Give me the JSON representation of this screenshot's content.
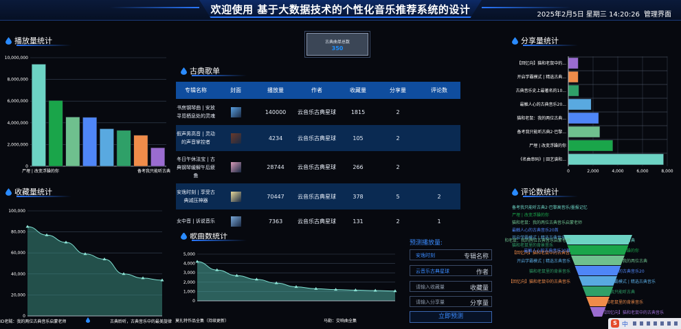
{
  "header": {
    "title": "欢迎使用 基于大数据技术的个性化音乐推荐系统的设计",
    "datetime": "2025年2月5日 星期三 14:20:26",
    "admin": "管理界面"
  },
  "summary": {
    "label": "古典曲单总数",
    "value": "350"
  },
  "panels": {
    "plays": "播放量统计",
    "collect": "收藏量统计",
    "table": "古典歌单",
    "songs": "歌曲数统计",
    "share": "分享量统计",
    "comments": "评论数统计"
  },
  "table": {
    "headers": [
      "专辑名称",
      "封面",
      "播放量",
      "作者",
      "收藏量",
      "分享量",
      "评论数"
    ],
    "rows": [
      {
        "name_line1": "书房钢琴曲 | 安放",
        "name_line2": "寻觅栖息处的灵魂",
        "plays": "140000",
        "author": "云音乐古典星球",
        "collect": "1815",
        "share": "2",
        "comments": ""
      },
      {
        "name_line1": "假声男高音 | 灵动",
        "name_line2": "的声音掌控者",
        "plays": "4234",
        "author": "云音乐古典星球",
        "collect": "105",
        "share": "2",
        "comments": ""
      },
      {
        "name_line1": "冬日午休法宝 | 古",
        "name_line2": "典钢琴缓解午后疲",
        "name_line3": "惫",
        "plays": "28744",
        "author": "云音乐古典星球",
        "collect": "266",
        "share": "2",
        "comments": ""
      },
      {
        "name_line1": "安逸时刻 | 享受古",
        "name_line2": "典减压神器",
        "plays": "70447",
        "author": "云音乐古典星球",
        "collect": "378",
        "share": "5",
        "comments": "2"
      },
      {
        "name_line1": "女中音 | 诉说音乐",
        "name_line2": "",
        "plays": "7363",
        "author": "云音乐古典星球",
        "collect": "131",
        "share": "2",
        "comments": "1"
      }
    ]
  },
  "predict": {
    "title": "预测播放量:",
    "fields": [
      {
        "value": "安逸时刻",
        "label": "专辑名称"
      },
      {
        "value": "云音乐古典星球",
        "label": "作者"
      },
      {
        "value": "请输入收藏量",
        "label": "收藏量"
      },
      {
        "value": "请输入分享量",
        "label": "分享量"
      }
    ],
    "button": "立即预测"
  },
  "chart_data": [
    {
      "type": "bar",
      "title": "播放量统计",
      "categories": [
        "尸埋 | 改变浮躁的你",
        "",
        "",
        "",
        "",
        "",
        "",
        "备考我只能听古典"
      ],
      "values": [
        9400000,
        6050000,
        4530000,
        4500000,
        3450000,
        3300000,
        2850000,
        1700000
      ],
      "colors": [
        "#6dd3c4",
        "#1aa54a",
        "#6fc08e",
        "#4f86f7",
        "#59a9e0",
        "#2fa068",
        "#f08c4a",
        "#9a6cd0"
      ],
      "yticks": [
        "0",
        "2,000,000",
        "4,000,000",
        "6,000,000",
        "8,000,000",
        "10,000,000"
      ],
      "ylim": [
        0,
        10000000
      ]
    },
    {
      "type": "area",
      "title": "收藏量统计",
      "values": [
        85000,
        77000,
        70000,
        59000,
        54000,
        40000,
        36000,
        34000
      ],
      "xlabels": [
        "ID老贼：我的两位古典音乐启蒙老师",
        "古典聆听，古典音乐中的最美旋律"
      ],
      "yticks": [
        "0",
        "20,000",
        "40,000",
        "60,000",
        "80,000",
        "100,000"
      ],
      "ylim": [
        0,
        100000
      ]
    },
    {
      "type": "area",
      "title": "歌曲数统计",
      "values": [
        4200,
        3300,
        2700,
        2300,
        1900,
        1500,
        1300,
        1200,
        1150,
        1100,
        1050
      ],
      "xlabels": [
        "莫扎特作品全集（持续更新）",
        "马勒：交响曲全集"
      ],
      "yticks": [
        "0",
        "1,000",
        "2,000",
        "3,000",
        "4,000",
        "5,000"
      ],
      "ylim": [
        0,
        5000
      ]
    },
    {
      "type": "bar",
      "title": "分享量统计",
      "orientation": "horizontal",
      "categories": [
        "【回忆向】猫和老鼠中的...",
        "开启学霸模式 | 精选古典...",
        "古典音乐史上最著名的10...",
        "最触人心的古典音乐20...",
        "猫和老鼠：我的两位古典...",
        "备考我只能听古典2·巴黎...",
        "尸埋 | 改变浮躁的你",
        "《名曲串码》| 田艺谱和..."
      ],
      "values": [
        800,
        800,
        850,
        1850,
        2450,
        2550,
        3600,
        7700
      ],
      "colors": [
        "#9a6cd0",
        "#f08c4a",
        "#2fa068",
        "#59a9e0",
        "#4f86f7",
        "#6fc08e",
        "#1aa54a",
        "#6dd3c4"
      ],
      "xticks": [
        "0",
        "2,000",
        "4,000",
        "6,000",
        "8,000"
      ],
      "xlim": [
        0,
        8000
      ]
    },
    {
      "type": "funnel",
      "title": "评论数统计",
      "legend": [
        "备考我只能听古典2·巴黎高音乐/墨报记忆",
        "尸埋 | 改变浮躁的你",
        "猫和老鼠：我的两位古典音乐启蒙老师",
        "最触人心的古典音乐20首",
        "开启学霸模式 | 精选古典音乐",
        "猫和老鼠里的背景音乐",
        "【回忆向】猫和老鼠中的古典音乐"
      ],
      "left_labels": [
        "猫和老鼠：我的两位古典音乐启蒙老师",
        "最触人心的古典音乐20首",
        "开启学霸模式 | 精选古典音乐",
        "猫和老鼠里的背景音乐",
        "【回忆向】猫和老鼠中的古典音乐"
      ],
      "right_labels": [
        "备考我只能听古典",
        "尸埋 | 改变浮躁的你",
        "猫和老鼠：我的两位古典",
        "最触人心的古典音乐20",
        "开启学霸模式 | 精选古典音乐",
        "备考我只能听古典",
        "猫和老鼠里的背景音乐",
        "【回忆向】猫和老鼠中的古典音乐"
      ],
      "colors": [
        "#6dd3c4",
        "#1aa54a",
        "#6fc08e",
        "#4f86f7",
        "#59a9e0",
        "#2fa068",
        "#f08c4a",
        "#9a6cd0"
      ]
    }
  ],
  "taskbar": {
    "ime": "S",
    "label": "中"
  }
}
